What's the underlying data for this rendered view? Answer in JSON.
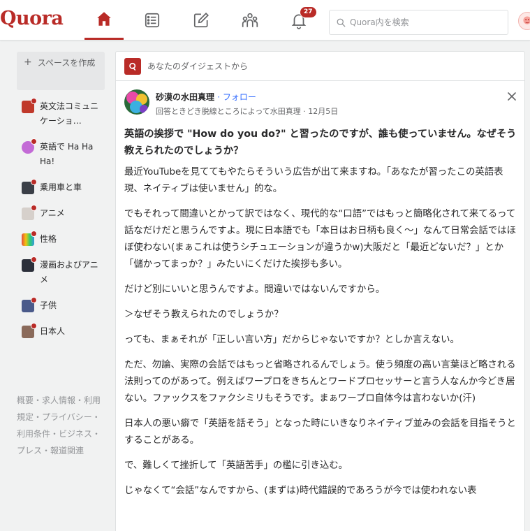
{
  "header": {
    "logo": "Quora",
    "notification_count": "27",
    "search_placeholder": "Quora内を検索"
  },
  "sidebar": {
    "create_space_label": "スペースを作成",
    "items": [
      {
        "label": "英文法コミュニケーショ…"
      },
      {
        "label": "英語で Ha Ha Ha!"
      },
      {
        "label": "乗用車と車"
      },
      {
        "label": "アニメ"
      },
      {
        "label": "性格"
      },
      {
        "label": "漫画およびアニメ"
      },
      {
        "label": "子供"
      },
      {
        "label": "日本人"
      }
    ],
    "footer": "概要・求人情報・利用規定・プライバシー・利用条件・ビジネス・プレス・報道関連"
  },
  "feed": {
    "digest_label": "あなたのダイジェストから",
    "author_name": "砂漠の水田真理",
    "follow_label": "フォロー",
    "meta": "回答ときどき脱線ところによって水田真理 · 12月5日",
    "question": "英語の挨拶で \"How do you do?\" と習ったのですが、誰も使っていません。なぜそう教えられたのでしょうか？",
    "paragraphs": [
      "最近YouTubeを見ててもやたらそういう広告が出て来ますね。「あなたが習ったこの英語表現、ネイティブは使いません」的な。",
      "でもそれって間違いとかって訳ではなく、現代的な“口語”ではもっと簡略化されて来てるって話なだけだと思うんですよ。現に日本語でも「本日はお日柄も良く～」なんて日常会話ではほぼ使わない(まぁこれは使うシチュエーションが違うかw)大阪だと「最近どないだ？」とか「儲かってまっか？」みたいにくだけた挨拶も多い。",
      "だけど別にいいと思うんですよ。間違いではないんですから。",
      "＞なぜそう教えられたのでしょうか？",
      "っても、まぁそれが「正しい言い方」だからじゃないですか？としか言えない。",
      "ただ、勿論、実際の会話ではもっと省略されるんでしょう。使う頻度の高い言葉ほど略される法則ってのがあって。例えばワープロをきちんとワードプロセッサーと言う人なんか今どき居ない。ファックスをファクシミリもそうです。まぁワープロ自体今は言わないか(汗)",
      "日本人の悪い癖で「英語を話そう」となった時にいきなりネイティブ並みの会話を目指そうとすることがある。",
      "で、難しくて挫折して「英語苦手」の檻に引き込む。",
      "じゃなくて“会話”なんですから、(まずは)時代錯誤的であろうが今では使われない表"
    ]
  }
}
